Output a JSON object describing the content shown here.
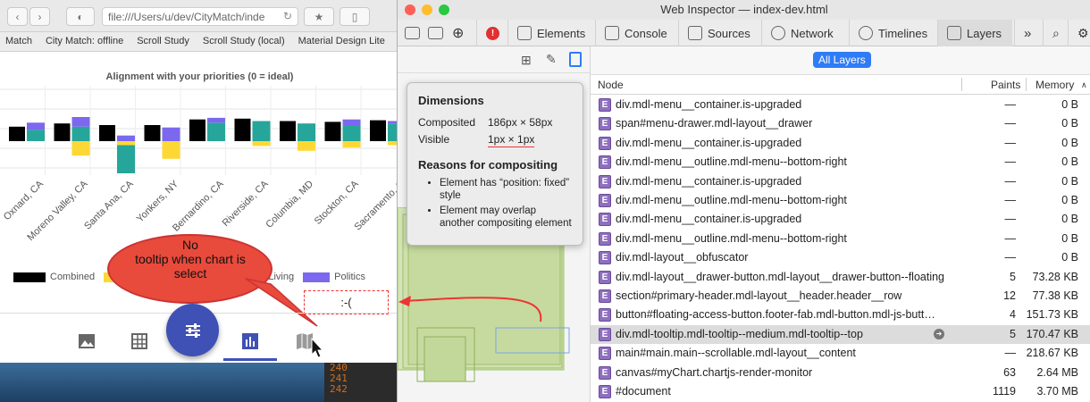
{
  "browser": {
    "url": "file:///Users/u/dev/CityMatch/inde",
    "bookmarks": [
      "Match",
      "City Match: offline",
      "Scroll Study",
      "Scroll Study (local)",
      "Material Design Lite"
    ],
    "chart_title": "Alignment with your priorities (0 = ideal)",
    "legend": [
      {
        "label": "Combined",
        "color": "#000000"
      },
      {
        "label": "",
        "color": "#fdd835"
      },
      {
        "label": "of Living",
        "color": "#26a69a"
      },
      {
        "label": "Politics",
        "color": "#7b68ee"
      }
    ],
    "callout": "No\ntooltip when chart is\nselect",
    "smiley": ":-(",
    "code_lines": [
      "240",
      "241",
      "242"
    ]
  },
  "chart_data": {
    "type": "bar",
    "title": "Alignment with your priorities (0 = ideal)",
    "categories": [
      "Oxnard, CA",
      "Moreno Valley, CA",
      "Santa Ana, CA",
      "Yonkers, NY",
      "Bernardino, CA",
      "Riverside, CA",
      "Columbia, MD",
      "Stockton, CA",
      "Sacramento, C"
    ],
    "series": [
      {
        "name": "Combined",
        "values": [
          18,
          22,
          20,
          20,
          27,
          28,
          25,
          24,
          26
        ]
      },
      {
        "name": "",
        "values": [
          0,
          -18,
          -5,
          -22,
          2,
          -6,
          -12,
          -8,
          -5
        ]
      },
      {
        "name": "of Living",
        "values": [
          14,
          18,
          -35,
          0,
          23,
          25,
          22,
          20,
          22
        ]
      },
      {
        "name": "Politics",
        "values": [
          9,
          12,
          7,
          17,
          6,
          0,
          0,
          7,
          3
        ]
      }
    ]
  },
  "inspector": {
    "title": "Web Inspector — index-dev.html",
    "tabs": [
      "Elements",
      "Console",
      "Sources",
      "Network",
      "Timelines",
      "Layers"
    ],
    "more": "»",
    "filter_label": "All Layers",
    "popover": {
      "title": "Dimensions",
      "composited_label": "Composited",
      "composited_value": "186px × 58px",
      "visible_label": "Visible",
      "visible_value": "1px × 1px",
      "reasons_title": "Reasons for compositing",
      "reasons": [
        "Element has “position: fixed” style",
        "Element may overlap another compositing element"
      ]
    },
    "columns": {
      "node": "Node",
      "paints": "Paints",
      "memory": "Memory"
    },
    "rows": [
      {
        "node": "div.mdl-menu__container.is-upgraded",
        "paints": "—",
        "memory": "0 B"
      },
      {
        "node": "span#menu-drawer.mdl-layout__drawer",
        "paints": "—",
        "memory": "0 B"
      },
      {
        "node": "div.mdl-menu__container.is-upgraded",
        "paints": "—",
        "memory": "0 B"
      },
      {
        "node": "div.mdl-menu__outline.mdl-menu--bottom-right",
        "paints": "—",
        "memory": "0 B"
      },
      {
        "node": "div.mdl-menu__container.is-upgraded",
        "paints": "—",
        "memory": "0 B"
      },
      {
        "node": "div.mdl-menu__outline.mdl-menu--bottom-right",
        "paints": "—",
        "memory": "0 B"
      },
      {
        "node": "div.mdl-menu__container.is-upgraded",
        "paints": "—",
        "memory": "0 B"
      },
      {
        "node": "div.mdl-menu__outline.mdl-menu--bottom-right",
        "paints": "—",
        "memory": "0 B"
      },
      {
        "node": "div.mdl-layout__obfuscator",
        "paints": "—",
        "memory": "0 B"
      },
      {
        "node": "div.mdl-layout__drawer-button.mdl-layout__drawer-button--floating",
        "paints": "5",
        "memory": "73.28 KB"
      },
      {
        "node": "section#primary-header.mdl-layout__header.header__row",
        "paints": "12",
        "memory": "77.38 KB"
      },
      {
        "node": "button#floating-access-button.footer-fab.mdl-button.mdl-js-butt…",
        "paints": "4",
        "memory": "151.73 KB"
      },
      {
        "node": "div.mdl-tooltip.mdl-tooltip--medium.mdl-tooltip--top",
        "paints": "5",
        "memory": "170.47 KB",
        "selected": true
      },
      {
        "node": "main#main.main--scrollable.mdl-layout__content",
        "paints": "—",
        "memory": "218.67 KB"
      },
      {
        "node": "canvas#myChart.chartjs-render-monitor",
        "paints": "63",
        "memory": "2.64 MB"
      },
      {
        "node": "#document",
        "paints": "1119",
        "memory": "3.70 MB"
      }
    ]
  }
}
